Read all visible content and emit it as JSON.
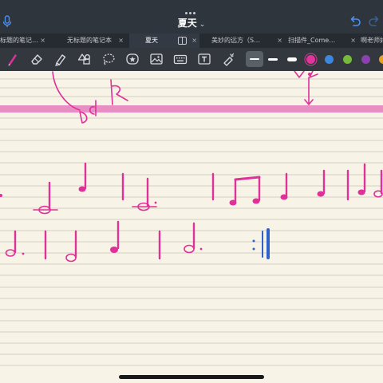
{
  "window": {
    "title": "夏天",
    "title_chevron": "⌄"
  },
  "tabs": [
    {
      "label": "标题的笔记…",
      "active": false
    },
    {
      "label": "无标题的笔记本",
      "active": false
    },
    {
      "label": "夏天",
      "active": true
    },
    {
      "label": "美妙的远方（S…",
      "active": false
    },
    {
      "label": "扫描件_Come…",
      "active": false
    },
    {
      "label": "啊老师好",
      "active": false
    }
  ],
  "tab_close_glyph": "×",
  "toolbar": {
    "tools": [
      "pen-icon",
      "eraser-icon",
      "highlighter-icon",
      "shapes-icon",
      "lasso-icon",
      "sticker-icon",
      "image-icon",
      "keyboard-icon",
      "text-box-icon",
      "laser-pointer-icon"
    ],
    "thickness_options": [
      "thin",
      "medium",
      "thick"
    ],
    "selected_thickness": "thin",
    "colors": [
      "#e0359b",
      "#3a86e0",
      "#77b93c",
      "#8e3fb0",
      "#e8a11a"
    ]
  },
  "colors": {
    "ink_pink": "#e0309a",
    "ink_blue": "#2d63c8",
    "staff_line": "#c8c3b8",
    "highlight_band": "#e78fc3",
    "paper": "#f7f3e6"
  }
}
